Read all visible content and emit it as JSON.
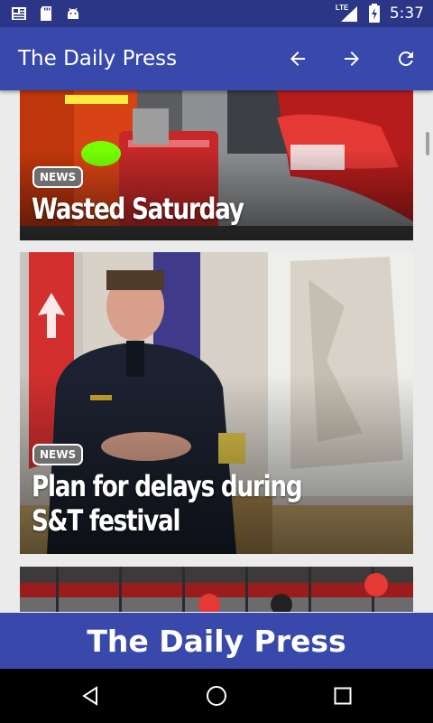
{
  "status_bar": {
    "time": "5:37",
    "network": "LTE",
    "icons": [
      "news-icon",
      "sd-card-icon",
      "android-icon",
      "signal-icon",
      "battery-charging-icon"
    ]
  },
  "app_bar": {
    "title": "The Daily Press",
    "actions": [
      "back-arrow-icon",
      "forward-arrow-icon",
      "refresh-icon"
    ]
  },
  "articles": [
    {
      "category": "NEWS",
      "headline": "Wasted Saturday"
    },
    {
      "category": "NEWS",
      "headline": "Plan for delays during S&T festival"
    },
    {
      "category": "",
      "headline": ""
    }
  ],
  "footer": {
    "title": "The Daily Press"
  },
  "nav_bar": {
    "buttons": [
      "back-triangle-icon",
      "home-circle-icon",
      "recents-square-icon"
    ]
  }
}
